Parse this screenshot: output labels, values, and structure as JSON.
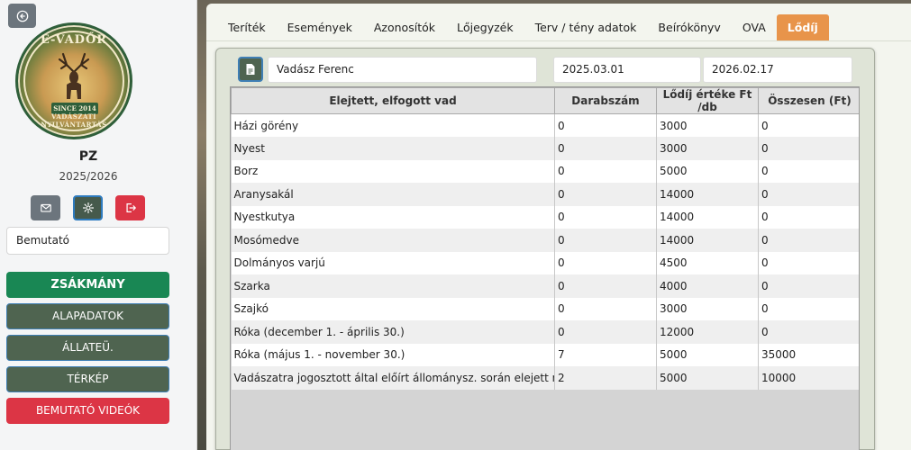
{
  "sidebar": {
    "logo": {
      "top_text": "E-VADŐR",
      "since_text": "SINCE 2014",
      "bottom_text": "VADÁSZATI NYILVÁNTARTÁS"
    },
    "user_code": "PZ",
    "season": "2025/2026",
    "select_value": "Bemutató",
    "nav": [
      {
        "label": "ZSÁKMÁNY"
      },
      {
        "label": "ALAPADATOK"
      },
      {
        "label": "ÁLLATEÜ."
      },
      {
        "label": "TÉRKÉP"
      },
      {
        "label": "BEMUTATÓ VIDEÓK"
      }
    ]
  },
  "tabs": [
    {
      "label": "Teríték"
    },
    {
      "label": "Események"
    },
    {
      "label": "Azonosítók"
    },
    {
      "label": "Lőjegyzék"
    },
    {
      "label": "Terv / tény adatok"
    },
    {
      "label": "Beírókönyv"
    },
    {
      "label": "OVA"
    },
    {
      "label": "Lődíj"
    }
  ],
  "active_tab": "Lődíj",
  "filters": {
    "hunter": "Vadász Ferenc",
    "date_from": "2025.03.01",
    "date_to": "2026.02.17"
  },
  "table": {
    "headers": [
      "Elejtett, elfogott vad",
      "Darabszám",
      "Lődíj értéke Ft /db",
      "Összesen (Ft)"
    ],
    "rows": [
      {
        "name": "Házi görény",
        "count": "0",
        "fee": "3000",
        "total": "0"
      },
      {
        "name": "Nyest",
        "count": "0",
        "fee": "3000",
        "total": "0"
      },
      {
        "name": "Borz",
        "count": "0",
        "fee": "5000",
        "total": "0"
      },
      {
        "name": "Aranysakál",
        "count": "0",
        "fee": "14000",
        "total": "0"
      },
      {
        "name": "Nyestkutya",
        "count": "0",
        "fee": "14000",
        "total": "0"
      },
      {
        "name": "Mosómedve",
        "count": "0",
        "fee": "14000",
        "total": "0"
      },
      {
        "name": "Dolmányos varjú",
        "count": "0",
        "fee": "4500",
        "total": "0"
      },
      {
        "name": "Szarka",
        "count": "0",
        "fee": "4000",
        "total": "0"
      },
      {
        "name": "Szajkó",
        "count": "0",
        "fee": "3000",
        "total": "0"
      },
      {
        "name": "Róka (december 1. - április 30.)",
        "count": "0",
        "fee": "12000",
        "total": "0"
      },
      {
        "name": "Róka (május 1. - november 30.)",
        "count": "7",
        "fee": "5000",
        "total": "35000"
      },
      {
        "name": "Vadászatra jogosztott által előírt állománysz. során elejett nagyvad",
        "count": "2",
        "fee": "5000",
        "total": "10000"
      }
    ]
  },
  "colors": {
    "accent_tab": "#e8944a",
    "primary": "#198754",
    "secondary": "#4f6450",
    "danger": "#dc3545"
  }
}
